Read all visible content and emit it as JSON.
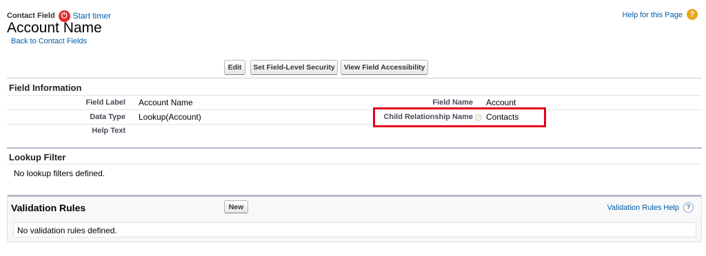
{
  "header": {
    "object_type": "Contact Field",
    "timer_link": "Start timer",
    "title": "Account Name",
    "back_link": "Back to Contact Fields",
    "help_link": "Help for this Page"
  },
  "toolbar": {
    "edit": "Edit",
    "field_level_security": "Set Field-Level Security",
    "field_accessibility": "View Field Accessibility"
  },
  "field_info": {
    "title": "Field Information",
    "left": [
      {
        "label": "Field Label",
        "value": "Account Name"
      },
      {
        "label": "Data Type",
        "value": "Lookup(Account)"
      },
      {
        "label": "Help Text",
        "value": ""
      }
    ],
    "right": [
      {
        "label": "Field Name",
        "value": "Account"
      },
      {
        "label": "Child Relationship Name",
        "value": "Contacts"
      }
    ]
  },
  "lookup_filter": {
    "title": "Lookup Filter",
    "message": "No lookup filters defined."
  },
  "validation_rules": {
    "title": "Validation Rules",
    "new_button": "New",
    "help_link": "Validation Rules Help",
    "message": "No validation rules defined."
  },
  "icons": {
    "timer": "power-icon",
    "help_page": "help-circle-icon",
    "info": "info-icon",
    "question": "question-icon"
  },
  "colors": {
    "link": "#015ba7",
    "highlight_border": "#e4001b",
    "timer_icon": "#e32b2b",
    "help_icon": "#e8a71c"
  }
}
